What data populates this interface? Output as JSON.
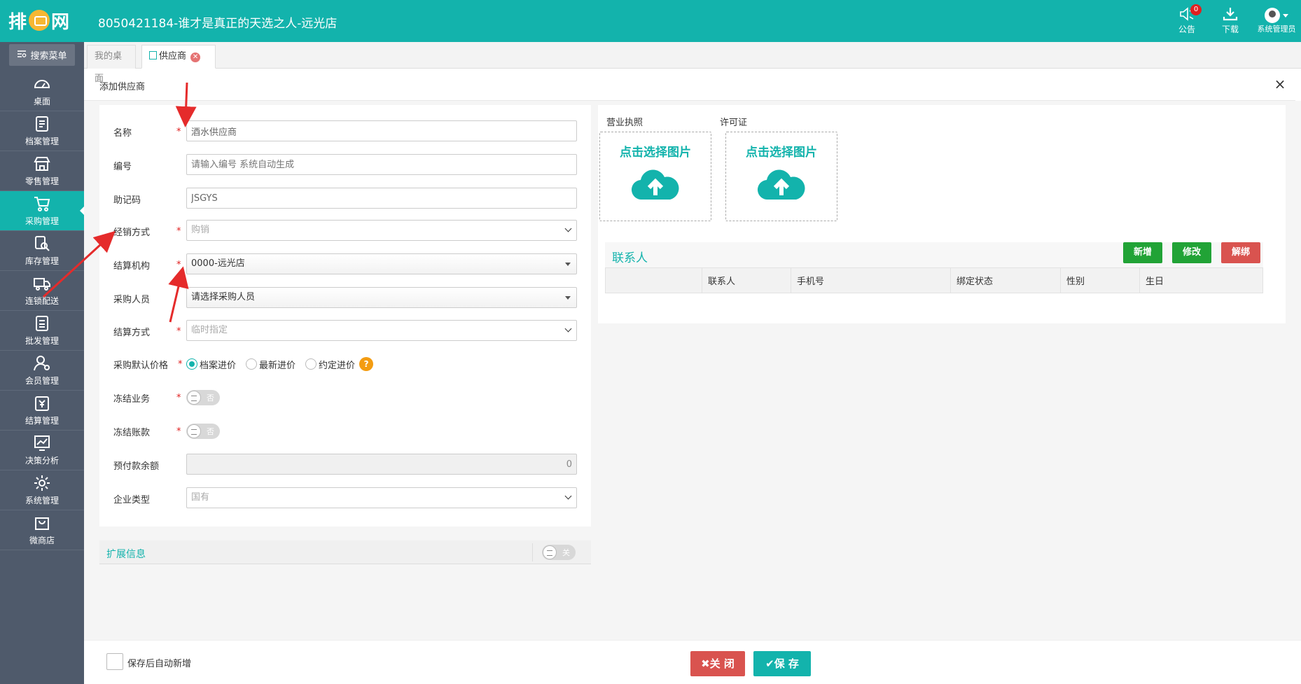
{
  "app": {
    "logo_text": "排队网",
    "title": "8050421184-谁才是真正的天选之人-远光店"
  },
  "top_actions": {
    "notice_label": "公告",
    "notice_count": "0",
    "download_label": "下载",
    "user_label": "系统管理员"
  },
  "sidebar": {
    "search_label": "搜索菜单",
    "items": [
      {
        "label": "桌面",
        "icon": "dashboard-icon"
      },
      {
        "label": "档案管理",
        "icon": "archive-icon"
      },
      {
        "label": "零售管理",
        "icon": "store-icon"
      },
      {
        "label": "采购管理",
        "icon": "cart-icon",
        "active": true
      },
      {
        "label": "库存管理",
        "icon": "inventory-search-icon"
      },
      {
        "label": "连锁配送",
        "icon": "truck-icon"
      },
      {
        "label": "批发管理",
        "icon": "wholesale-icon"
      },
      {
        "label": "会员管理",
        "icon": "member-icon"
      },
      {
        "label": "结算管理",
        "icon": "settlement-icon"
      },
      {
        "label": "决策分析",
        "icon": "chart-icon"
      },
      {
        "label": "系统管理",
        "icon": "gear-icon"
      },
      {
        "label": "微商店",
        "icon": "bag-icon"
      }
    ]
  },
  "tabs": [
    {
      "label": "我的桌面"
    },
    {
      "label": "供应商"
    }
  ],
  "dialog": {
    "title": "添加供应商",
    "close": "×"
  },
  "form": {
    "name_label": "名称",
    "name_value": "酒水供应商",
    "code_label": "编号",
    "code_placeholder": "请输入编号 系统自动生成",
    "mnemonic_label": "助记码",
    "mnemonic_value": "JSGYS",
    "sales_mode_label": "经销方式",
    "sales_mode_value": "购销",
    "settle_org_label": "结算机构",
    "settle_org_value": "0000-远光店",
    "buyer_label": "采购人员",
    "buyer_value": "请选择采购人员",
    "settle_method_label": "结算方式",
    "settle_method_value": "临时指定",
    "default_price_label": "采购默认价格",
    "price_options": [
      "档案进价",
      "最新进价",
      "约定进价"
    ],
    "price_selected": "档案进价",
    "freeze_business_label": "冻结业务",
    "freeze_business_value": "否",
    "freeze_payment_label": "冻结账款",
    "freeze_payment_value": "否",
    "prepaid_label": "预付款余额",
    "prepaid_value": "0",
    "company_type_label": "企业类型",
    "company_type_value": "国有",
    "required_mark": "*"
  },
  "extension": {
    "title": "扩展信息",
    "toggle_value": "关"
  },
  "images": {
    "license_label": "营业执照",
    "permit_label": "许可证",
    "upload_text": "点击选择图片"
  },
  "contacts": {
    "title": "联系人",
    "add_label": "新增",
    "edit_label": "修改",
    "unbind_label": "解绑",
    "columns": [
      "",
      "联系人",
      "手机号",
      "绑定状态",
      "性别",
      "生日"
    ]
  },
  "footer": {
    "auto_new_label": "保存后自动新增",
    "close_label": "✖关 闭",
    "save_label": "✔保 存"
  },
  "colors": {
    "brand": "#13b3ac",
    "sidebar": "#4f5a6b",
    "danger": "#d9534f",
    "success": "#21a336",
    "annotation_arrow": "#e52b2b"
  }
}
